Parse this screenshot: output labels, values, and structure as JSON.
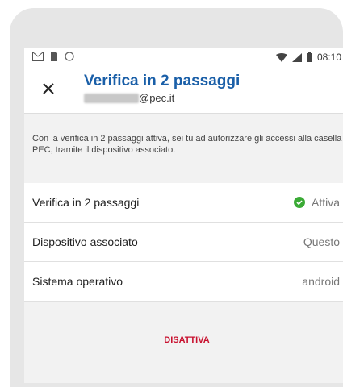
{
  "statusbar": {
    "time": "08:10",
    "left_icons": [
      "gmail-icon",
      "sim-icon",
      "circle-icon"
    ],
    "right_icons": [
      "wifi-icon",
      "signal-icon",
      "battery-icon"
    ]
  },
  "appbar": {
    "title": "Verifica in 2 passaggi",
    "subtitle": "@pec.it"
  },
  "info": {
    "text": "Con la verifica in 2 passaggi attiva, sei tu ad autorizzare gli accessi alla casella PEC, tramite il dispositivo associato."
  },
  "rows": [
    {
      "label": "Verifica in 2 passaggi",
      "value": "Attiva"
    },
    {
      "label": "Dispositivo associato",
      "value": "Questo"
    },
    {
      "label": "Sistema operativo",
      "value": "android"
    }
  ],
  "action": {
    "label": "DISATTIVA"
  },
  "colors": {
    "title": "#1a5fa8",
    "check": "#3aaa35",
    "danger": "#c8102e"
  }
}
